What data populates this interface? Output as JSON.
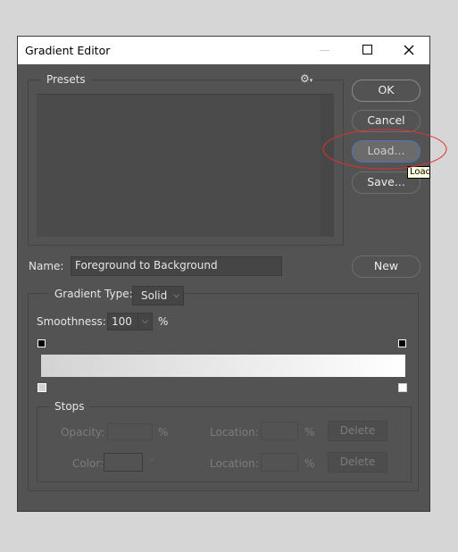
{
  "window": {
    "title": "Gradient Editor",
    "minimize_icon": "minimize-icon",
    "maximize_icon": "maximize-icon",
    "close_icon": "close-icon"
  },
  "presets": {
    "label": "Presets",
    "menu_icon": "gear-icon"
  },
  "buttons": {
    "ok": "OK",
    "cancel": "Cancel",
    "load": "Load...",
    "save": "Save...",
    "new": "New"
  },
  "tooltip": "Load",
  "name": {
    "label": "Name:",
    "value": "Foreground to Background"
  },
  "gradient": {
    "type_label": "Gradient Type:",
    "type_value": "Solid",
    "smoothness_label": "Smoothness:",
    "smoothness_value": "100",
    "percent": "%",
    "start_color": "#d3d3d3",
    "end_color": "#ffffff"
  },
  "stops": {
    "label": "Stops",
    "opacity_label": "Opacity:",
    "color_label": "Color:",
    "location_label": "Location:",
    "percent": "%",
    "delete": "Delete"
  },
  "annotation_color": "#e03030"
}
